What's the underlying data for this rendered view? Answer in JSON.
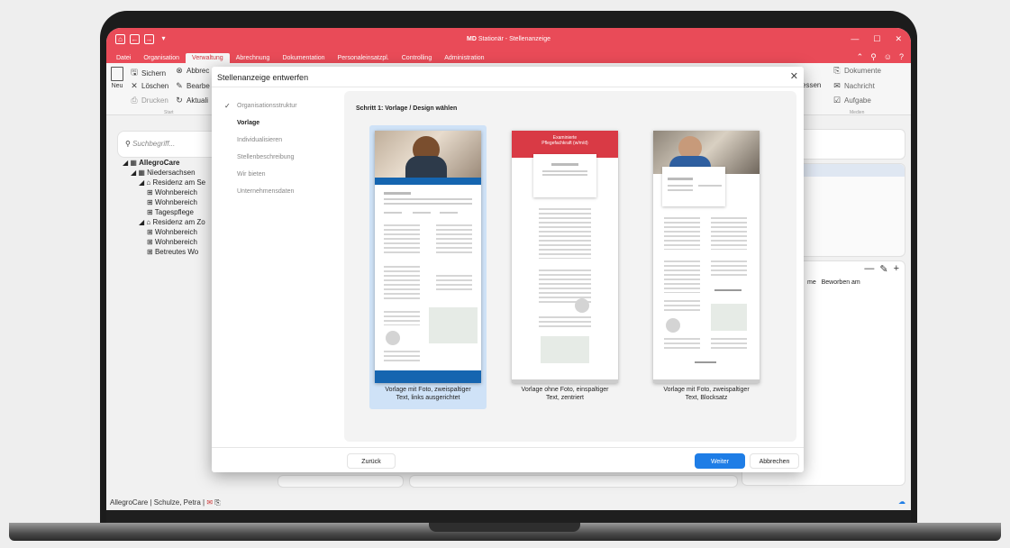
{
  "window": {
    "app_name": "MD",
    "title_rest": "Stationär - Stellenanzeige"
  },
  "menu": {
    "items": [
      "Datei",
      "Organisation",
      "Verwaltung",
      "Abrechnung",
      "Dokumentation",
      "Personaleinsatzpl.",
      "Controlling",
      "Administration"
    ],
    "active_index": 2
  },
  "ribbon": {
    "neu": "Neu",
    "sichern": "Sichern",
    "abbrechen": "Abbrec",
    "loeschen": "Löschen",
    "bearbeiten": "Bearbe",
    "drucken": "Drucken",
    "aktualisieren": "Aktuali",
    "start_group": "Start",
    "essen": "essen",
    "dokumente": "Dokumente",
    "nachricht": "Nachricht",
    "aufgabe": "Aufgabe",
    "medien_group": "Medien"
  },
  "sidebar": {
    "search_placeholder": "Suchbegriff...",
    "tree": [
      {
        "label": "AllegroCare",
        "level": 0,
        "bold": true
      },
      {
        "label": "Niedersachsen",
        "level": 1
      },
      {
        "label": "Residenz am Se",
        "level": 2
      },
      {
        "label": "Wohnbereich",
        "level": 3
      },
      {
        "label": "Wohnbereich",
        "level": 3
      },
      {
        "label": "Tagespflege",
        "level": 3
      },
      {
        "label": "Residenz am Zo",
        "level": 2
      },
      {
        "label": "Wohnbereich",
        "level": 3
      },
      {
        "label": "Wohnbereich",
        "level": 3
      },
      {
        "label": "Betreutes Wo",
        "level": 3
      }
    ]
  },
  "right_panel": {
    "col_me": "me",
    "col_beworben": "Beworben am"
  },
  "status": {
    "text": "AllegroCare | Schulze, Petra |"
  },
  "dialog": {
    "title": "Stellenanzeige entwerfen",
    "steps": [
      {
        "label": "Organisationsstruktur",
        "state": "done"
      },
      {
        "label": "Vorlage",
        "state": "current"
      },
      {
        "label": "Individualisieren",
        "state": "todo"
      },
      {
        "label": "Stellenbeschreibung",
        "state": "todo"
      },
      {
        "label": "Wir bieten",
        "state": "todo"
      },
      {
        "label": "Unternehmensdaten",
        "state": "todo"
      }
    ],
    "step_heading": "Schritt 1: Vorlage / Design wählen",
    "templates": [
      {
        "caption1": "Vorlage mit Foto, zweispaltiger",
        "caption2": "Text, links ausgerichtet",
        "selected": true
      },
      {
        "caption1": "Vorlage ohne Foto, einspaltiger",
        "caption2": "Text, zentriert",
        "selected": false,
        "header_text1": "Examinierte",
        "header_text2": "Pflegefachkraft (w/m/d)"
      },
      {
        "caption1": "Vorlage mit Foto, zweispaltiger",
        "caption2": "Text, Blocksatz",
        "selected": false
      }
    ],
    "back_label": "Zurück",
    "next_label": "Weiter",
    "cancel_label": "Abbrechen"
  },
  "colors": {
    "accent_red": "#e94b58",
    "primary_blue": "#1e7de6",
    "template_blue": "#1565b0",
    "template_red": "#d93a45"
  }
}
